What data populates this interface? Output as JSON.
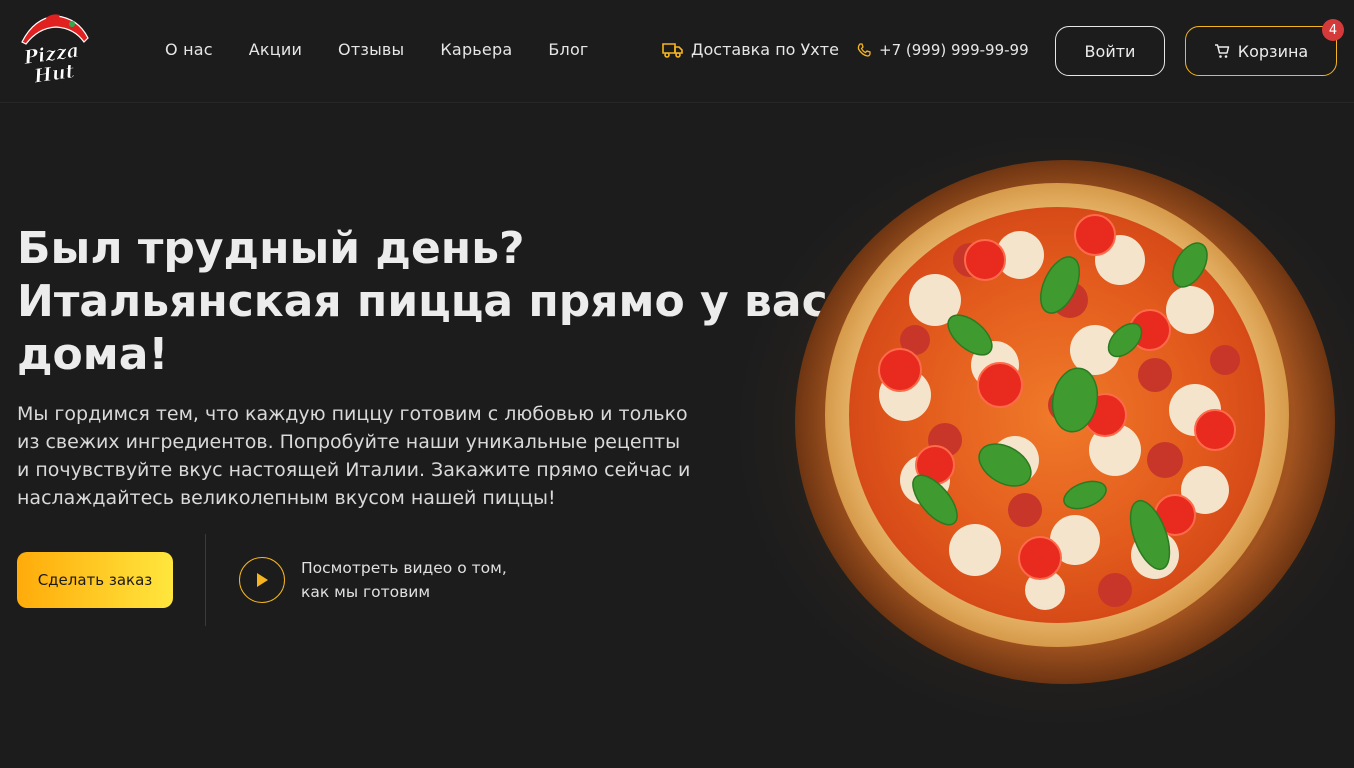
{
  "header": {
    "logo_text": [
      "Pizza",
      "Hut"
    ],
    "nav": [
      "О нас",
      "Акции",
      "Отзывы",
      "Карьера",
      "Блог"
    ],
    "delivery": "Доставка по Ухте",
    "phone": "+7 (999) 999-99-99",
    "login_label": "Войти",
    "cart_label": "Корзина",
    "cart_count": "4"
  },
  "hero": {
    "title_lines": [
      "Был трудный день?",
      "Итальянская пицца прямо у вас",
      "дома!"
    ],
    "text_lines": [
      "Мы гордимся тем, что каждую пиццу готовим с любовью и только",
      "из свежих ингредиентов. Попробуйте наши уникальные рецепты",
      "и почувствуйте вкус настоящей Италии. Закажите прямо сейчас и",
      "наслаждайтесь великолепным вкусом нашей пиццы!"
    ],
    "order_label": "Сделать заказ",
    "video_lines": [
      "Посмотреть видео о том,",
      "как мы готовим"
    ]
  },
  "colors": {
    "background": "#1c1c1d",
    "accent": "#f6b41f",
    "badge": "#d43a3a",
    "logo_red": "#e1211f"
  },
  "icons": [
    "truck-icon",
    "phone-icon",
    "cart-icon",
    "play-icon"
  ]
}
